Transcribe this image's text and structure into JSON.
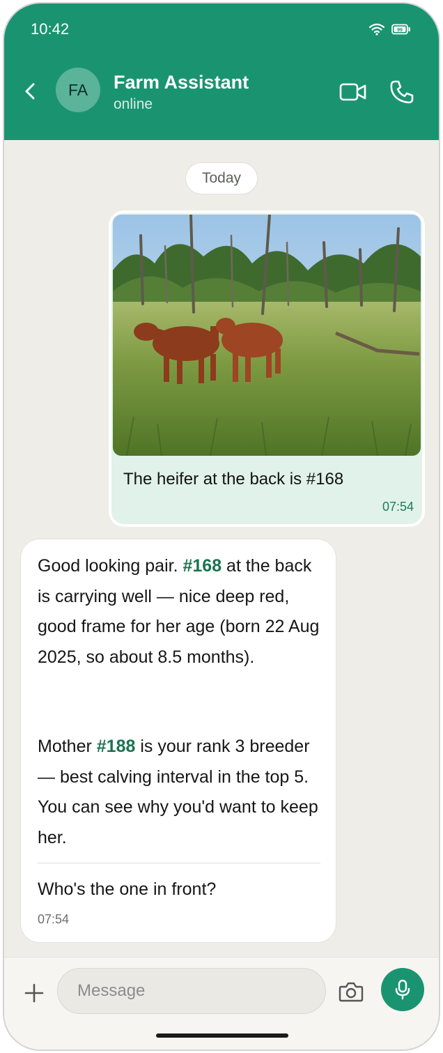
{
  "status_bar": {
    "time": "10:42",
    "icons": [
      "wifi-icon",
      "battery-icon"
    ],
    "battery_label": "99"
  },
  "header": {
    "back_icon": "chevron-left-icon",
    "avatar_initials": "FA",
    "contact_name": "Farm Assistant",
    "contact_status": "online",
    "actions": [
      "video-call-icon",
      "phone-icon"
    ]
  },
  "colors": {
    "brand": "#1a9470",
    "outgoing_bubble": "#e0f2e9",
    "highlight": "#1a7350",
    "background": "#efede7"
  },
  "day_separator": "Today",
  "messages": [
    {
      "direction": "outgoing",
      "image": "photo of two red cattle standing in a grassy paddock with gum trees",
      "text": "The heifer at the back is #168",
      "time": "07:54"
    },
    {
      "direction": "incoming",
      "paragraph1": {
        "before": "Good looking pair. ",
        "highlight": "#168",
        "after": " at the back is carrying well — nice deep red, good frame for her age (born 22 Aug 2025, so about 8.5 months)."
      },
      "paragraph2": {
        "before": "Mother ",
        "highlight": "#188",
        "after": " is your rank 3 breeder — best calving interval in the top 5. You can see why you'd want to keep her."
      },
      "question": "Who's the one in front?",
      "time": "07:54"
    }
  ],
  "input_bar": {
    "placeholder": "Message",
    "icons": [
      "plus-icon",
      "camera-icon",
      "microphone-icon"
    ]
  }
}
